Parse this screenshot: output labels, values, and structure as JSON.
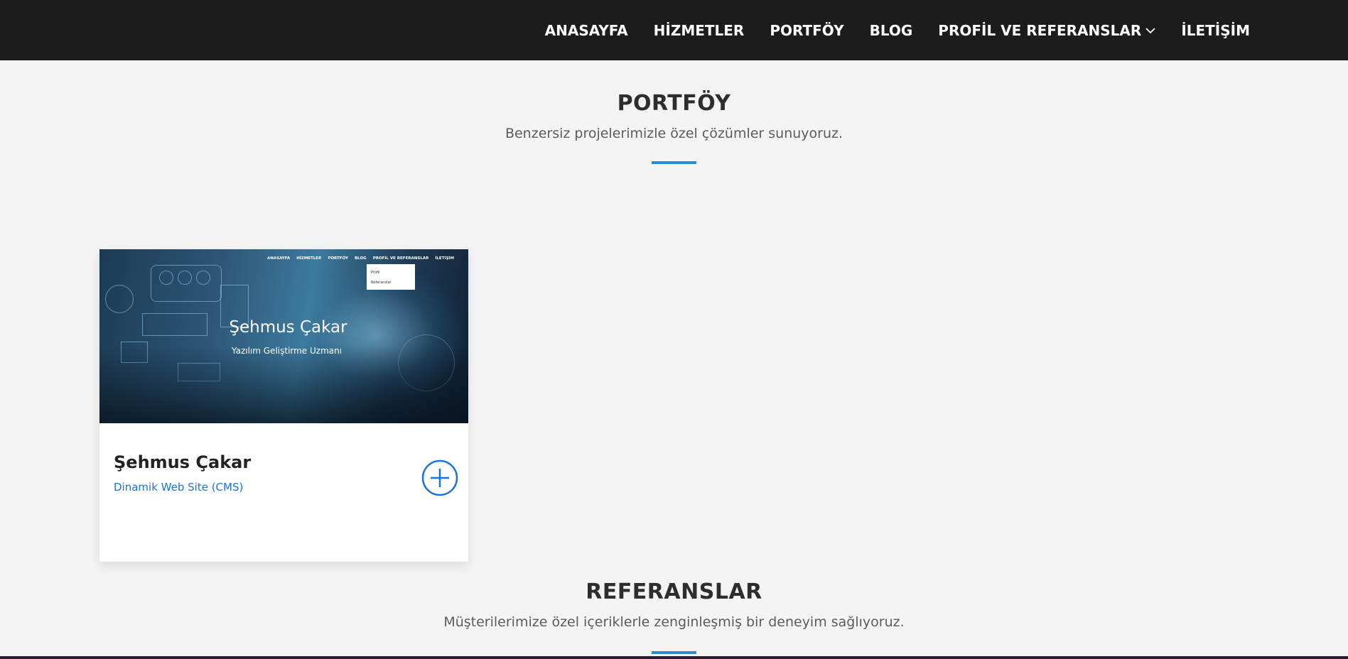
{
  "nav": {
    "items": [
      {
        "label": "ANASAYFA"
      },
      {
        "label": "HİZMETLER"
      },
      {
        "label": "PORTFÖY"
      },
      {
        "label": "BLOG"
      },
      {
        "label": "PROFİL VE REFERANSLAR",
        "icon": "chevron-down-icon"
      },
      {
        "label": "İLETİŞİM"
      }
    ]
  },
  "portfolio": {
    "title": "PORTFÖY",
    "subtitle": "Benzersiz projelerimizle özel çözümler sunuyoruz.",
    "card": {
      "thumbnail": {
        "mini_nav": [
          "ANASAYFA",
          "HİZMETLER",
          "PORTFÖY",
          "BLOG",
          "PROFİL VE REFERANSLAR",
          "İLETİŞİM"
        ],
        "mini_dropdown": [
          "Profil",
          "Referanslar"
        ],
        "name": "Şehmus Çakar",
        "role": "Yazılım Geliştirme Uzmanı"
      },
      "title": "Şehmus Çakar",
      "category": "Dinamik Web Site (CMS)",
      "action_icon": "plus-circle-icon"
    }
  },
  "references": {
    "title": "REFERANSLAR",
    "subtitle": "Müşterilerimize özel içeriklerle zenginleşmiş bir deneyim sağlıyoruz."
  },
  "colors": {
    "nav_bg": "#1c1c1c",
    "page_bg": "#f4f4f4",
    "accent_line": "#2e8bd0",
    "link_blue": "#1a73d9"
  }
}
